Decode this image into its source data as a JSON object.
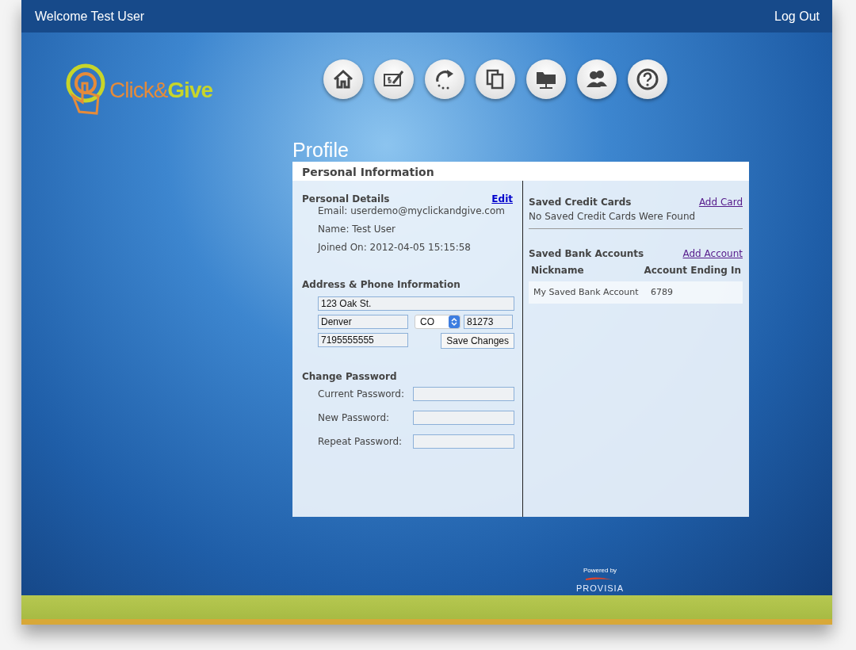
{
  "header": {
    "welcome": "Welcome Test User",
    "logout": "Log Out"
  },
  "logo": {
    "parts": [
      "Click&",
      "Give"
    ]
  },
  "page_title": "Profile",
  "panel": {
    "title": "Personal Information",
    "personal_details": {
      "heading": "Personal Details",
      "edit_link": "Edit",
      "lines": [
        "Email: userdemo@myclickandgive.com",
        "Name: Test User",
        "Joined On: 2012-04-05 15:15:58"
      ]
    },
    "address": {
      "heading": "Address & Phone Information",
      "street": "123 Oak St.",
      "city": "Denver",
      "state": "CO",
      "zip": "81273",
      "phone": "7195555555",
      "save_button": "Save Changes"
    },
    "change_password": {
      "heading": "Change Password",
      "fields": [
        {
          "label": "Current Password:"
        },
        {
          "label": "New Password:"
        },
        {
          "label": "Repeat Password:"
        }
      ]
    },
    "credit_cards": {
      "heading": "Saved Credit Cards",
      "add_link": "Add Card",
      "empty_message": "No Saved Credit Cards Were Found"
    },
    "bank_accounts": {
      "heading": "Saved Bank Accounts",
      "add_link": "Add Account",
      "columns": [
        "Nickname",
        "Account Ending In"
      ],
      "rows": [
        [
          "My Saved Bank Account",
          "6789"
        ]
      ]
    }
  },
  "footer": {
    "powered_by": "Powered by",
    "brand": "PROVISIA"
  }
}
